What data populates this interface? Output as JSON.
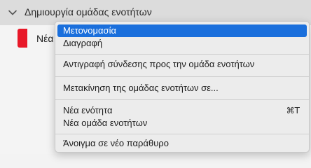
{
  "section_group": {
    "title": "Δημιουργία ομάδας ενοτήτων",
    "toggle_icon": "chevron-down-icon"
  },
  "section_list": {
    "items": [
      {
        "label": "Νέα ε",
        "color": "#e81828"
      }
    ]
  },
  "context_menu": {
    "rename": "Μετονομασία",
    "delete": "Διαγραφή",
    "copy_link": "Αντιγραφή σύνδεσης προς την ομάδα ενοτήτων",
    "move": "Μετακίνηση της ομάδας ενοτήτων σε...",
    "new_section": "Νέα ενότητα",
    "new_section_shortcut": "⌘T",
    "new_section_group": "Νέα ομάδα ενοτήτων",
    "open_new_window": "Άνοιγμα σε νέο παράθυρο",
    "highlight_color": "#1a6fdc"
  }
}
